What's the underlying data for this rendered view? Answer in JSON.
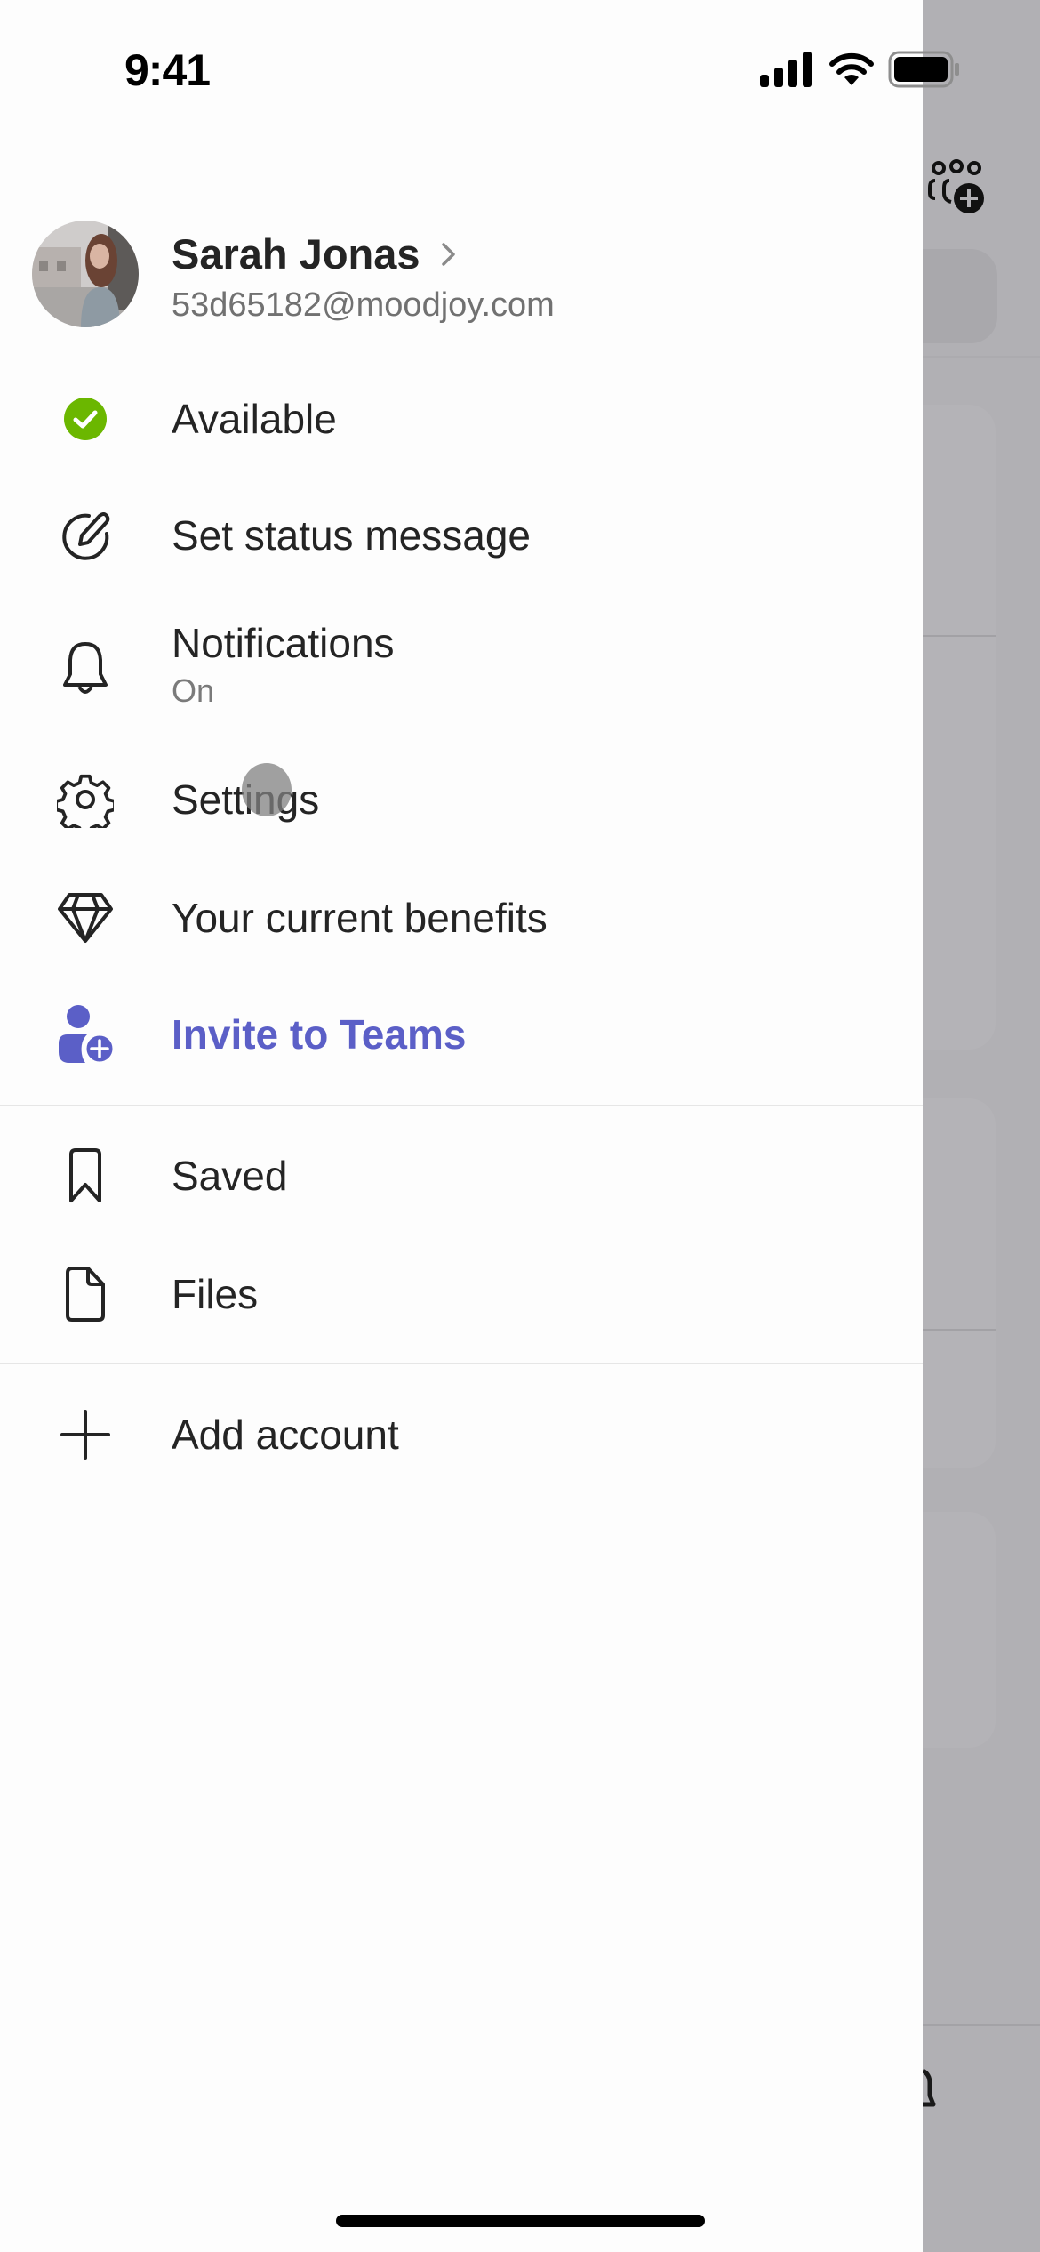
{
  "status_bar": {
    "time": "9:41",
    "icons": [
      "cellular-signal-icon",
      "wifi-icon",
      "battery-icon"
    ]
  },
  "profile": {
    "name": "Sarah Jonas",
    "email": "53d65182@moodjoy.com",
    "avatar": "profile-photo"
  },
  "menu": {
    "available": {
      "label": "Available",
      "icon": "status-available-icon",
      "color": "#6bb700"
    },
    "status_message": {
      "label": "Set status message",
      "icon": "edit-status-icon"
    },
    "notifications": {
      "label": "Notifications",
      "sublabel": "On",
      "icon": "bell-icon"
    },
    "settings": {
      "label": "Settings",
      "icon": "gear-icon"
    },
    "benefits": {
      "label": "Your current benefits",
      "icon": "diamond-icon"
    },
    "invite": {
      "label": "Invite to Teams",
      "icon": "person-add-icon",
      "color": "#5b5fc7"
    },
    "saved": {
      "label": "Saved",
      "icon": "bookmark-icon"
    },
    "files": {
      "label": "Files",
      "icon": "file-icon"
    },
    "add_account": {
      "label": "Add account",
      "icon": "plus-icon"
    }
  },
  "backdrop": {
    "header_icon": "new-team-icon",
    "tab_icon": "bell-icon"
  }
}
